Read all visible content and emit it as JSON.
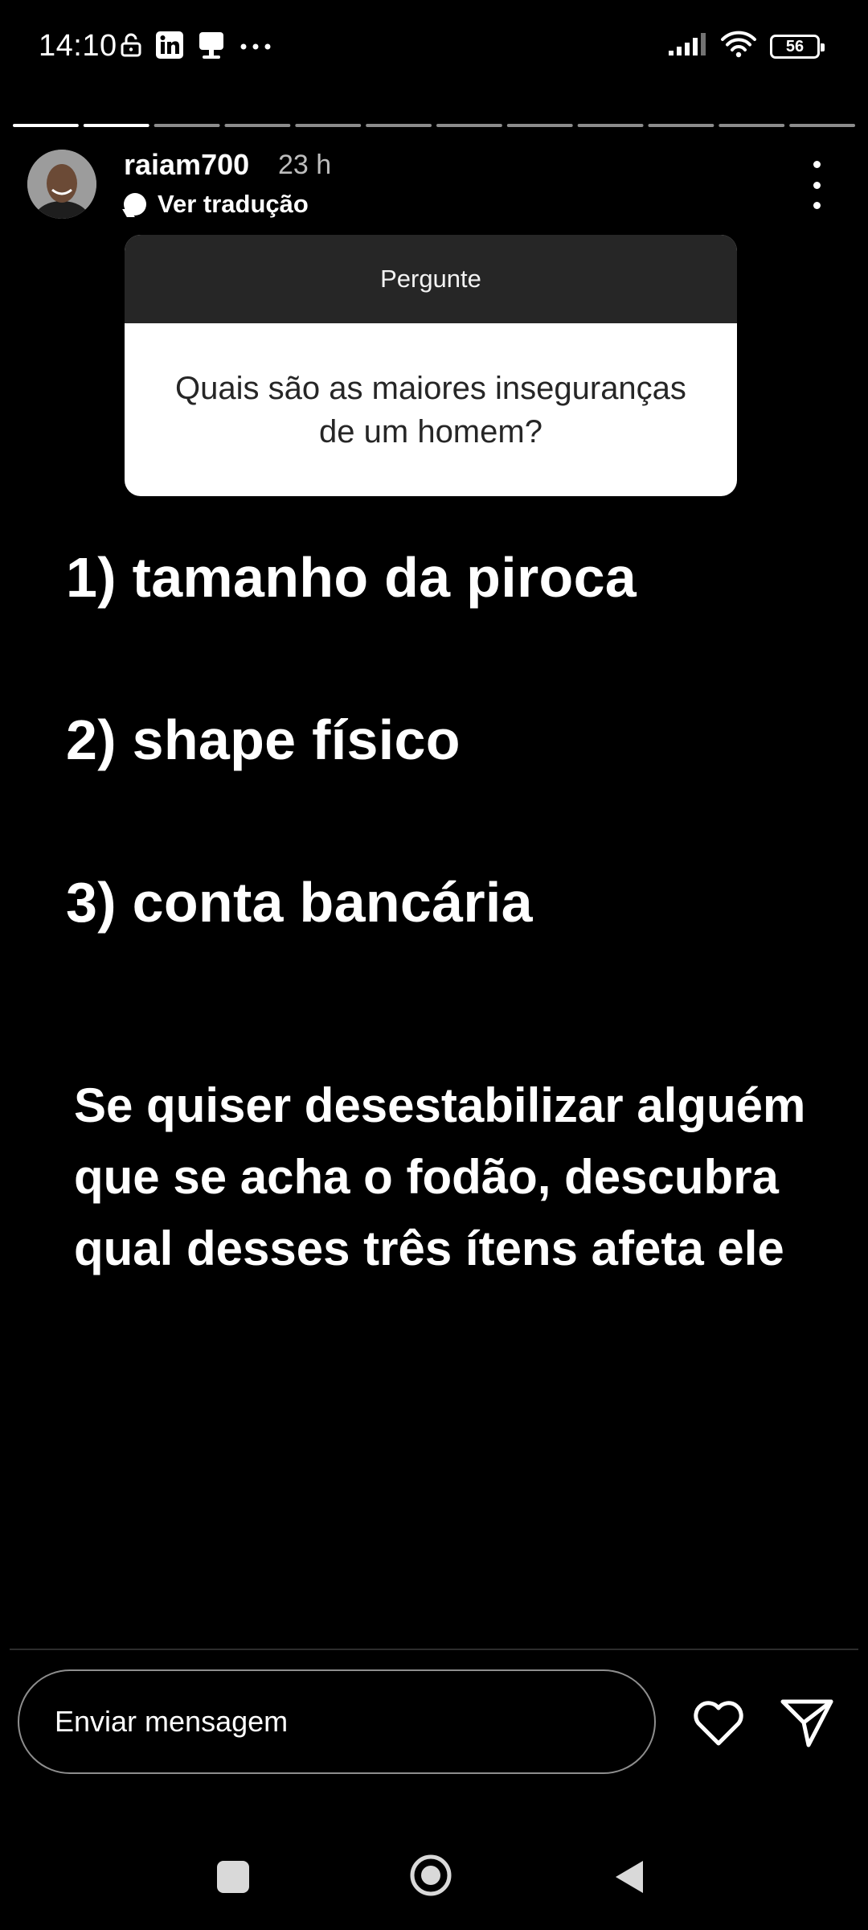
{
  "status_bar": {
    "time": "14:10",
    "left_icons": [
      "lock-open-icon",
      "linkedin-icon",
      "app-notification-icon",
      "more-notifications-icon"
    ],
    "right_icons": [
      "signal-icon",
      "wifi-icon",
      "battery-icon"
    ],
    "battery_level": "56"
  },
  "story": {
    "segments_total": 12,
    "segments_viewed": 2,
    "accent": "#ffffff"
  },
  "header": {
    "username": "raiam700",
    "time_ago": "23 h",
    "translate_label": "Ver tradução"
  },
  "sticker": {
    "title": "Pergunte",
    "question": "Quais são as maiores inseguranças de um homem?"
  },
  "content": {
    "item1": "1) tamanho da piroca",
    "item2": "2) shape físico",
    "item3": "3) conta bancária",
    "paragraph": "Se quiser desestabilizar alguém que se acha o fodão, descubra qual desses três ítens afeta ele"
  },
  "footer": {
    "message_placeholder": "Enviar mensagem",
    "like_icon": "heart-icon",
    "send_icon": "send-icon"
  },
  "nav": {
    "icons": [
      "recents-square-icon",
      "home-circle-icon",
      "back-triangle-icon"
    ]
  }
}
